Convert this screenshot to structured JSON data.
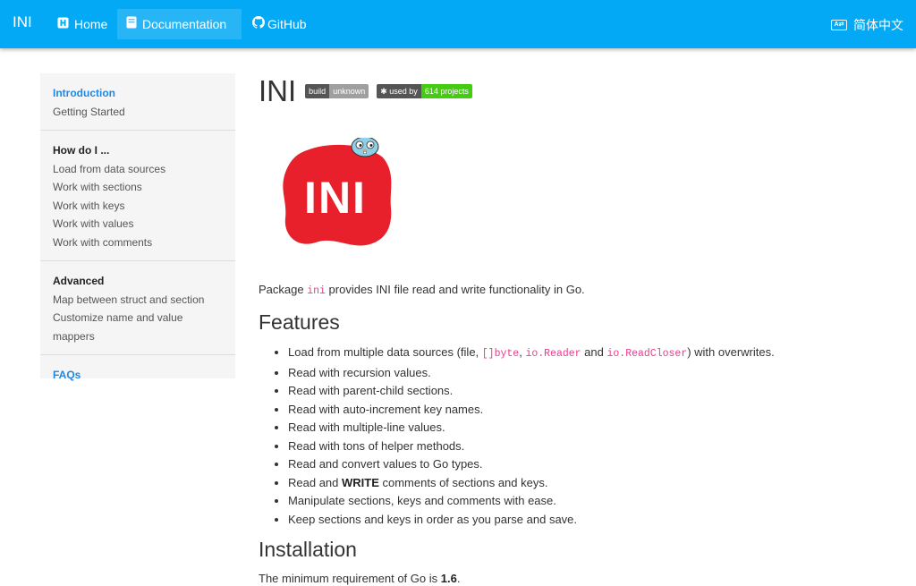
{
  "nav": {
    "brand": "INI",
    "items": [
      {
        "label": "Home",
        "icon": "home-icon"
      },
      {
        "label": "Documentation",
        "icon": "book-icon"
      },
      {
        "label": "GitHub",
        "icon": "github-icon"
      }
    ],
    "language": "简体中文",
    "language_icon": "translate-icon",
    "bg_color": "#03a9f4"
  },
  "sidebar": {
    "groups": [
      {
        "head": "Introduction",
        "items": [
          "Getting Started"
        ]
      },
      {
        "head": "How do I ...",
        "items": [
          "Load from data sources",
          "Work with sections",
          "Work with keys",
          "Work with values",
          "Work with comments"
        ]
      },
      {
        "head": "Advanced",
        "items": [
          "Map between struct and section",
          "Customize name and value mappers"
        ]
      },
      {
        "head": "FAQs",
        "items": []
      }
    ]
  },
  "main": {
    "title": "INI",
    "badges": [
      {
        "left": "build",
        "right": "unknown"
      },
      {
        "left": "used by",
        "right": "614 projects"
      }
    ],
    "logo_text": "INI",
    "intro_pre": "Package ",
    "intro_code": "ini",
    "intro_post": " provides INI file read and write functionality in Go.",
    "features_heading": "Features",
    "features": {
      "f1_pre": "Load from multiple data sources (file, ",
      "f1_c1": "[]byte",
      "f1_sep": ", ",
      "f1_c2": "io.Reader",
      "f1_and": " and ",
      "f1_c3": "io.ReadCloser",
      "f1_post": ") with overwrites.",
      "f2": "Read with recursion values.",
      "f3": "Read with parent-child sections.",
      "f4": "Read with auto-increment key names.",
      "f5": "Read with multiple-line values.",
      "f6": "Read with tons of helper methods.",
      "f7": "Read and convert values to Go types.",
      "f8_pre": "Read and ",
      "f8_bold": "WRITE",
      "f8_post": " comments of sections and keys.",
      "f9": "Manipulate sections, keys and comments with ease.",
      "f10": "Keep sections and keys in order as you parse and save."
    },
    "install_heading": "Installation",
    "req_pre": "The minimum requirement of Go is ",
    "req_version": "1.6",
    "req_post": "."
  }
}
